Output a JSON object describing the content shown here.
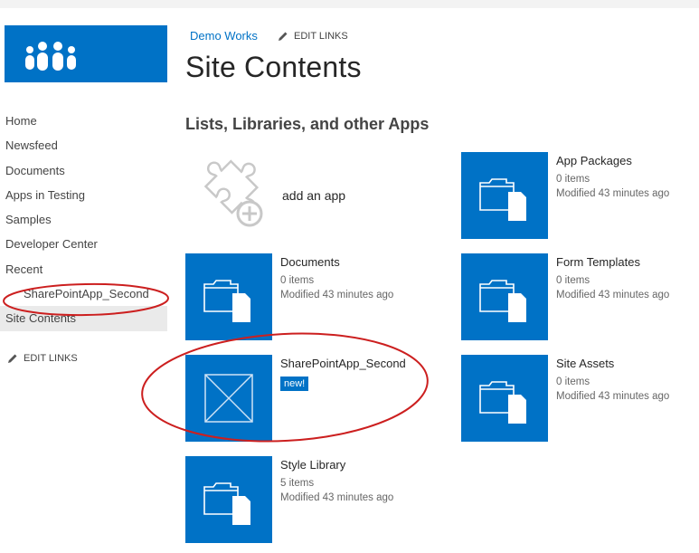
{
  "breadcrumb": {
    "site": "Demo Works",
    "edit_links": "EDIT LINKS"
  },
  "page": {
    "title": "Site Contents",
    "section_title": "Lists, Libraries, and other Apps"
  },
  "quick_launch": {
    "items": [
      "Home",
      "Newsfeed",
      "Documents",
      "Apps in Testing",
      "Samples",
      "Developer Center",
      "Recent",
      "SharePointApp_Second",
      "Site Contents"
    ],
    "edit_links": "EDIT LINKS"
  },
  "add_app": {
    "label": "add an app"
  },
  "tiles": {
    "documents": {
      "title": "Documents",
      "count": "0 items",
      "modified": "Modified 43 minutes ago"
    },
    "sharepointapp": {
      "title": "SharePointApp_Second",
      "badge": "new!"
    },
    "style_library": {
      "title": "Style Library",
      "count": "5 items",
      "modified": "Modified 43 minutes ago"
    },
    "app_packages": {
      "title": "App Packages",
      "count": "0 items",
      "modified": "Modified 43 minutes ago"
    },
    "form_templates": {
      "title": "Form Templates",
      "count": "0 items",
      "modified": "Modified 43 minutes ago"
    },
    "site_assets": {
      "title": "Site Assets",
      "count": "0 items",
      "modified": "Modified 43 minutes ago"
    }
  },
  "colors": {
    "accent": "#0072c6",
    "annotation": "#cc1f1f",
    "selected": "#eaeaea"
  }
}
